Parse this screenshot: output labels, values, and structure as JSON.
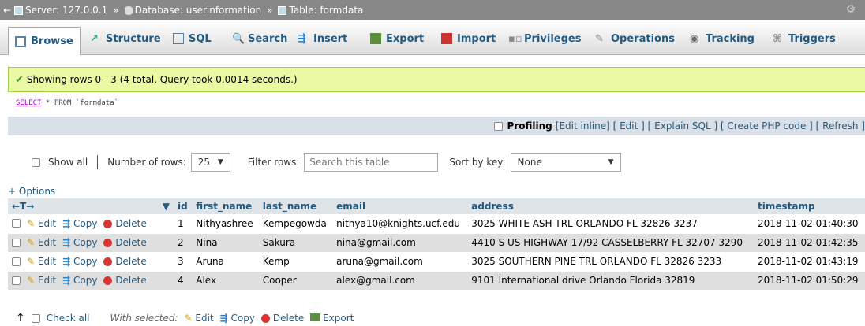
{
  "breadcrumb": {
    "server": "Server: 127.0.0.1",
    "database": "Database: userinformation",
    "table": "Table: formdata",
    "sep": "»"
  },
  "tabs": [
    {
      "label": "Browse",
      "icon": "browse-icon"
    },
    {
      "label": "Structure",
      "icon": "structure-icon"
    },
    {
      "label": "SQL",
      "icon": "sql-icon"
    },
    {
      "label": "Search",
      "icon": "search-icon"
    },
    {
      "label": "Insert",
      "icon": "insert-icon"
    },
    {
      "label": "Export",
      "icon": "export-icon"
    },
    {
      "label": "Import",
      "icon": "import-icon"
    },
    {
      "label": "Privileges",
      "icon": "privileges-icon"
    },
    {
      "label": "Operations",
      "icon": "operations-icon"
    },
    {
      "label": "Tracking",
      "icon": "tracking-icon"
    },
    {
      "label": "Triggers",
      "icon": "triggers-icon"
    }
  ],
  "message": "Showing rows 0 - 3 (4 total, Query took 0.0014 seconds.)",
  "sql": {
    "keyword": "SELECT",
    "rest": " * FROM `formdata`"
  },
  "sqlbar": {
    "profiling": "Profiling",
    "links": "[Edit inline] [ Edit ] [ Explain SQL ] [ Create PHP code ] [ Refresh ]"
  },
  "nav": {
    "show_all": "Show all",
    "rows_label": "Number of rows:",
    "rows_value": "25",
    "filter_label": "Filter rows:",
    "filter_placeholder": "Search this table",
    "sort_label": "Sort by key:",
    "sort_value": "None",
    "caret": "▼"
  },
  "options_link": "+ Options",
  "arrows": "←T→",
  "columns": [
    "id",
    "first_name",
    "last_name",
    "email",
    "address",
    "timestamp"
  ],
  "action_labels": {
    "edit": "Edit",
    "copy": "Copy",
    "delete": "Delete"
  },
  "rows": [
    {
      "id": "1",
      "first_name": "Nithyashree",
      "last_name": "Kempegowda",
      "email": "nithya10@knights.ucf.edu",
      "address": "3025 WHITE ASH TRL ORLANDO FL 32826 3237",
      "timestamp": "2018-11-02 01:40:30"
    },
    {
      "id": "2",
      "first_name": "Nina",
      "last_name": "Sakura",
      "email": "nina@gmail.com",
      "address": "4410 S US HIGHWAY 17/92 CASSELBERRY FL 32707 3290",
      "timestamp": "2018-11-02 01:42:35"
    },
    {
      "id": "3",
      "first_name": "Aruna",
      "last_name": "Kemp",
      "email": "aruna@gmail.com",
      "address": "3025 SOUTHERN PINE TRL ORLANDO FL 32826 3233",
      "timestamp": "2018-11-02 01:43:19"
    },
    {
      "id": "4",
      "first_name": "Alex",
      "last_name": "Cooper",
      "email": "alex@gmail.com",
      "address": "9101 International drive  Orlando Florida 32819",
      "timestamp": "2018-11-02 01:50:29"
    }
  ],
  "footer": {
    "check_all": "Check all",
    "with_selected": "With selected:",
    "edit": "Edit",
    "copy": "Copy",
    "delete": "Delete",
    "export": "Export"
  },
  "colors": {
    "link": "#235a81",
    "success_bg": "#ebf8a4",
    "header_bg": "#dfe4e9"
  }
}
